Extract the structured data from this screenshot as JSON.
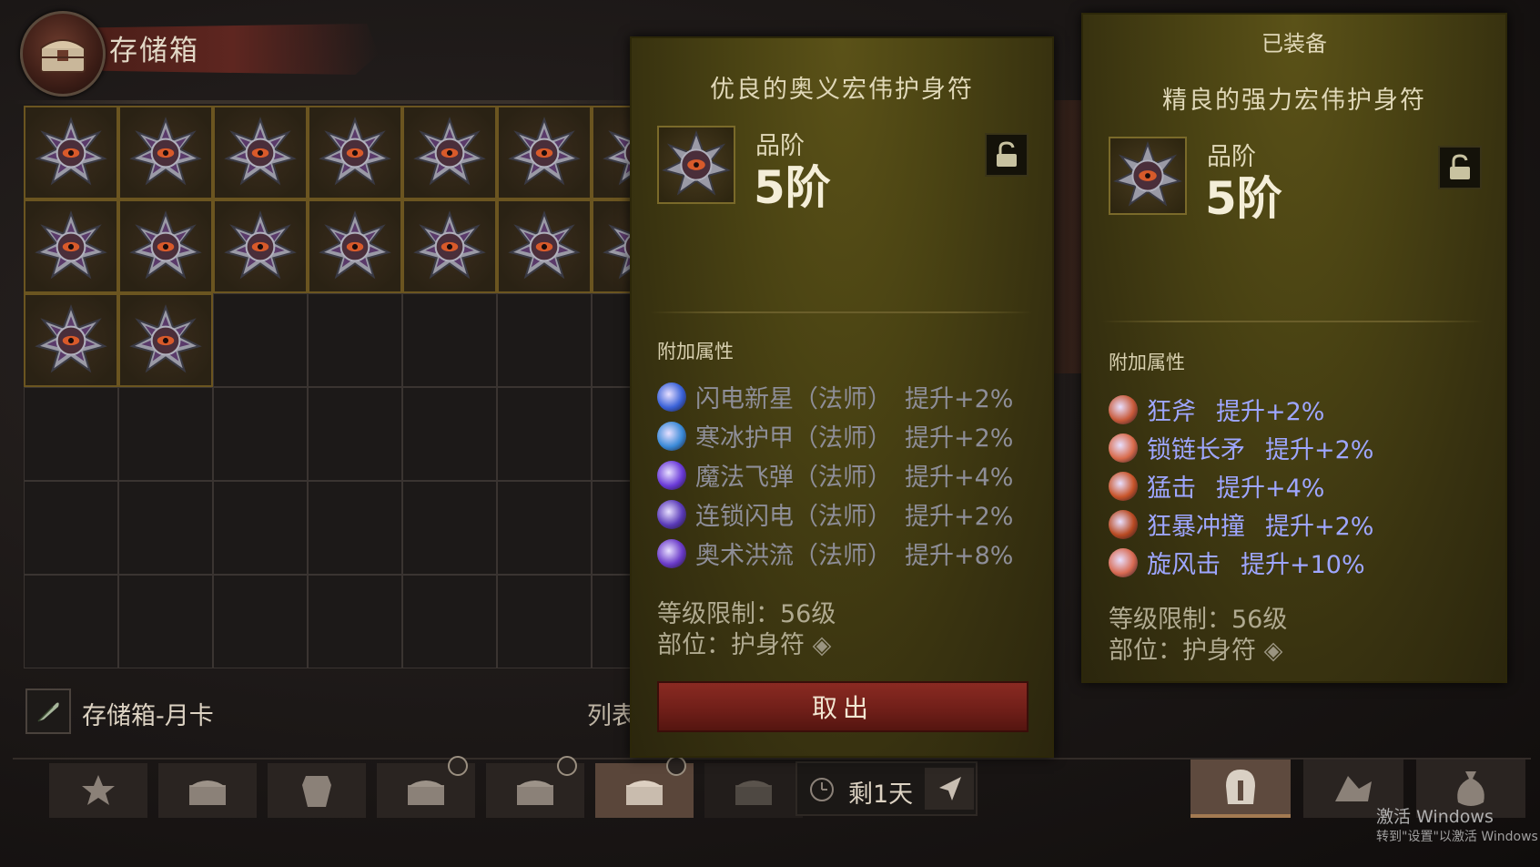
{
  "storage": {
    "title": "存储箱",
    "name": "存储箱-月卡",
    "list_label": "列表",
    "filled_counts": [
      7,
      7,
      2
    ]
  },
  "tooltip_left": {
    "title": "优良的奥义宏伟护身符",
    "tier_label": "品阶",
    "tier_value": "5阶",
    "section_label": "附加属性",
    "affixes": [
      {
        "skill": "闪电新星（法师）",
        "bonus": "提升+2%",
        "icon": "lightning-nova-icon"
      },
      {
        "skill": "寒冰护甲（法师）",
        "bonus": "提升+2%",
        "icon": "frost-armor-icon"
      },
      {
        "skill": "魔法飞弹（法师）",
        "bonus": "提升+4%",
        "icon": "magic-missile-icon"
      },
      {
        "skill": "连锁闪电（法师）",
        "bonus": "提升+2%",
        "icon": "chain-lightning-icon"
      },
      {
        "skill": "奥术洪流（法师）",
        "bonus": "提升+8%",
        "icon": "arcane-torrent-icon"
      }
    ],
    "level_req": "等级限制：56级",
    "slot": "部位：护身符",
    "take_button": "取出"
  },
  "tooltip_right": {
    "equipped_label": "已装备",
    "title": "精良的强力宏伟护身符",
    "tier_label": "品阶",
    "tier_value": "5阶",
    "section_label": "附加属性",
    "affixes": [
      {
        "skill": "狂斧",
        "bonus": "提升+2%",
        "icon": "frenzy-axe-icon"
      },
      {
        "skill": "锁链长矛",
        "bonus": "提升+2%",
        "icon": "chain-spear-icon"
      },
      {
        "skill": "猛击",
        "bonus": "提升+4%",
        "icon": "bash-icon"
      },
      {
        "skill": "狂暴冲撞",
        "bonus": "提升+2%",
        "icon": "charge-icon"
      },
      {
        "skill": "旋风击",
        "bonus": "提升+10%",
        "icon": "whirlwind-icon"
      }
    ],
    "level_req": "等级限制：56级",
    "slot": "部位：护身符"
  },
  "timer": {
    "text": "剩1天"
  },
  "watermark": {
    "line1": "激活 Windows",
    "line2": "转到\"设置\"以激活 Windows"
  },
  "colors": {
    "affix_left": "#8e8e98",
    "affix_right": "#9ea6ff",
    "take_button": "#7a241c",
    "panel": "#4a4313"
  }
}
